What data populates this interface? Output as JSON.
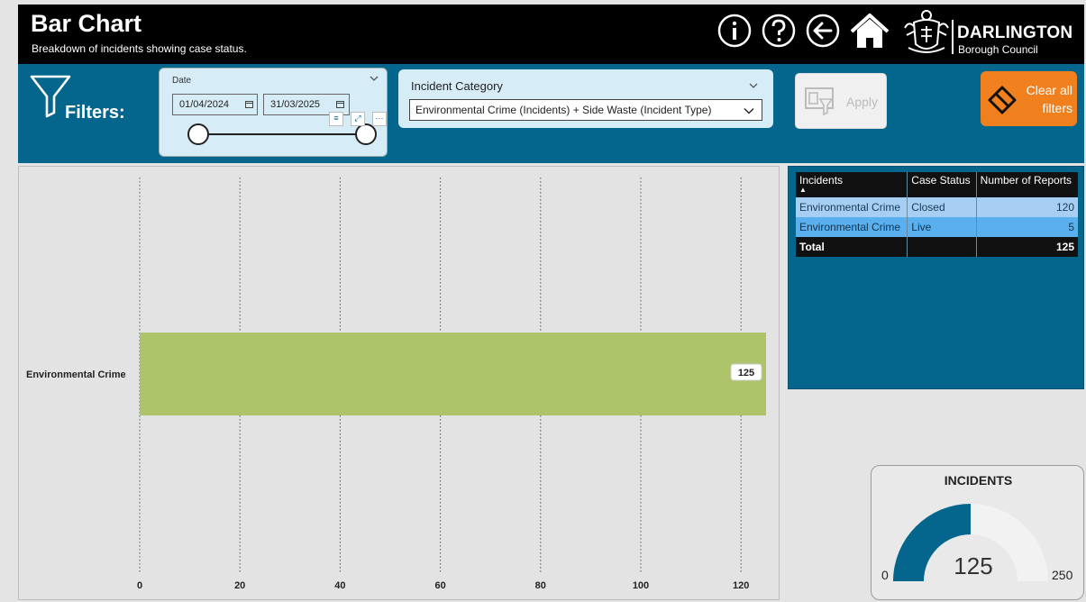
{
  "header": {
    "title": "Bar Chart",
    "subtitle": "Breakdown of incidents showing case status.",
    "logo_name": "DARLINGTON",
    "logo_sub": "Borough Council"
  },
  "icons": [
    "info-icon",
    "help-icon",
    "back-arrow-icon",
    "home-icon",
    "council-crest-logo",
    "funnel-icon",
    "calendar-icon",
    "chevron-down-icon",
    "apply-icon",
    "eraser-icon"
  ],
  "filters": {
    "label": "Filters:",
    "date": {
      "label": "Date",
      "start": "01/04/2024",
      "end": "31/03/2025"
    },
    "incident_category": {
      "label": "Incident Category",
      "selected": "Environmental Crime (Incidents) + Side Waste (Incident Type)"
    },
    "apply_label": "Apply",
    "clear_label": "Clear all filters"
  },
  "table": {
    "columns": [
      "Incidents",
      "Case Status",
      "Number of Reports"
    ],
    "rows": [
      [
        "Environmental Crime",
        "Closed",
        "120"
      ],
      [
        "Environmental Crime",
        "Live",
        "5"
      ]
    ],
    "total": [
      "Total",
      "",
      "125"
    ]
  },
  "gauge": {
    "title": "INCIDENTS",
    "value": 125,
    "value_label": "125",
    "min": 0,
    "min_label": "0",
    "max": 250,
    "max_label": "250",
    "fill_color": "#04668d",
    "track_color": "#f2f2f2"
  },
  "colors": {
    "header_bg": "#000000",
    "filter_band_bg": "#04668d",
    "clear_button_bg": "#f0801e",
    "bar_color": "#adc46b"
  },
  "chart_data": {
    "type": "bar",
    "orientation": "horizontal",
    "categories": [
      "Environmental Crime"
    ],
    "values": [
      125
    ],
    "data_labels": [
      "125"
    ],
    "xlim": [
      0,
      125
    ],
    "x_ticks": [
      0,
      20,
      40,
      60,
      80,
      100,
      120
    ],
    "grid": "vertical dotted"
  }
}
